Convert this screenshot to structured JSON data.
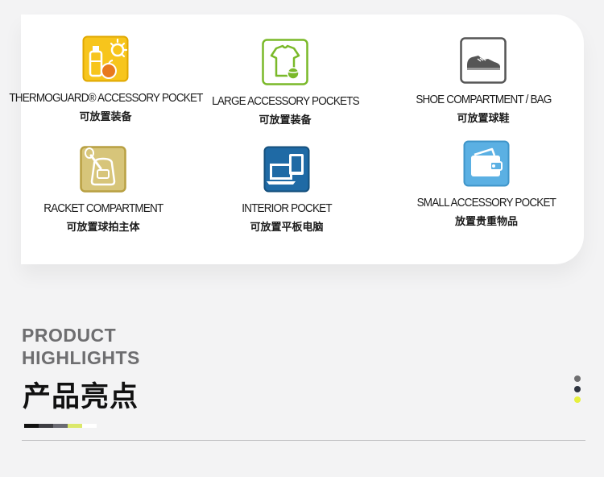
{
  "features": [
    {
      "icon": "thermoguard-bottle-sun-icon",
      "en": "THERMOGUARD® ACCESSORY POCKET",
      "cn": "可放置装备",
      "color": "#f7c51c"
    },
    {
      "icon": "tshirt-ball-icon",
      "en": "LARGE ACCESSORY POCKETS",
      "cn": "可放置装备",
      "color": "#7ab929"
    },
    {
      "icon": "shoe-icon",
      "en": "SHOE COMPARTMENT / BAG",
      "cn": "可放置球鞋",
      "color": "#555555"
    },
    {
      "icon": "racket-backpack-icon",
      "en": "RACKET COMPARTMENT",
      "cn": "可放置球拍主体",
      "color": "#b8a042"
    },
    {
      "icon": "laptop-tablet-icon",
      "en": "INTERIOR POCKET",
      "cn": "可放置平板电脑",
      "color": "#1f6aa5"
    },
    {
      "icon": "wallet-icon",
      "en": "SMALL ACCESSORY POCKET",
      "cn": "放置贵重物品",
      "color": "#5bb0e3"
    }
  ],
  "section": {
    "title_en_line1": "PRODUCT",
    "title_en_line2": "HIGHLIGHTS",
    "title_cn": "产品亮点"
  },
  "color_bar": [
    "#111111",
    "#3d3d42",
    "#6a6a72",
    "#dbe86a",
    "#ffffff"
  ],
  "pager_dots": [
    "#6e6e70",
    "#2e3440",
    "#e6f03c"
  ]
}
